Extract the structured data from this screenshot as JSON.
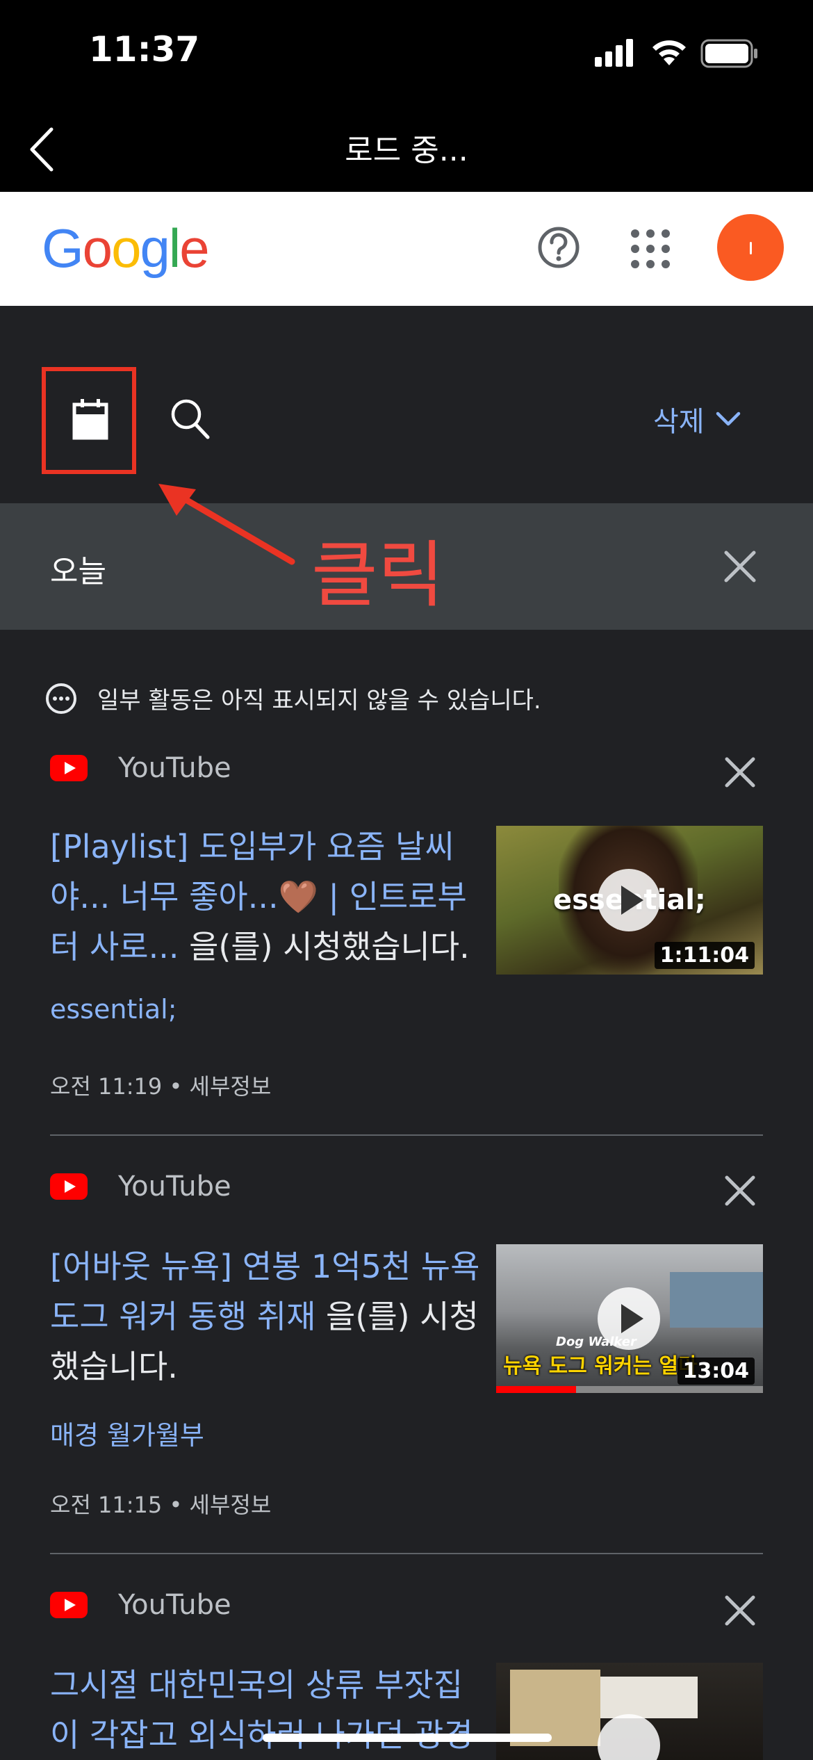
{
  "status": {
    "time": "11:37"
  },
  "nav": {
    "title": "로드 중..."
  },
  "header": {
    "logo": [
      "G",
      "o",
      "o",
      "g",
      "l",
      "e"
    ],
    "logo_colors": [
      "#4285F4",
      "#EA4335",
      "#FBBC05",
      "#4285F4",
      "#34A853",
      "#EA4335"
    ]
  },
  "toolbar": {
    "delete_label": "삭제"
  },
  "filter": {
    "today_label": "오늘"
  },
  "annotation": {
    "click_label": "클릭",
    "color": "#ea3323"
  },
  "notice": "일부 활동은 아직 표시되지 않을 수 있습니다.",
  "items": [
    {
      "source": "YouTube",
      "title_link": "[Playlist] 도입부가 요즘 날씨야... 너무 좋아...🤎 | 인트로부터 사로...",
      "title_suffix": " 을(를) 시청했습니다.",
      "channel": "essential;",
      "time": "오전 11:19",
      "details": "세부정보",
      "thumb_overlay": "essential;",
      "duration": "1:11:04"
    },
    {
      "source": "YouTube",
      "title_link": "[어바웃 뉴욕] 연봉 1억5천 뉴욕 도그 워커 동행 취재",
      "title_suffix": " 을(를) 시청했습니다.",
      "channel": "매경 월가월부",
      "time": "오전 11:15",
      "details": "세부정보",
      "thumb_overlay": "뉴욕 도그 워커는 얼마",
      "thumb_small": "Dog Walker",
      "duration": "13:04",
      "progress": 0.3
    },
    {
      "source": "YouTube",
      "title_link": "그시절 대한민국의 상류 부잣집이 각잡고 외식하러 나가던 광경"
    }
  ]
}
